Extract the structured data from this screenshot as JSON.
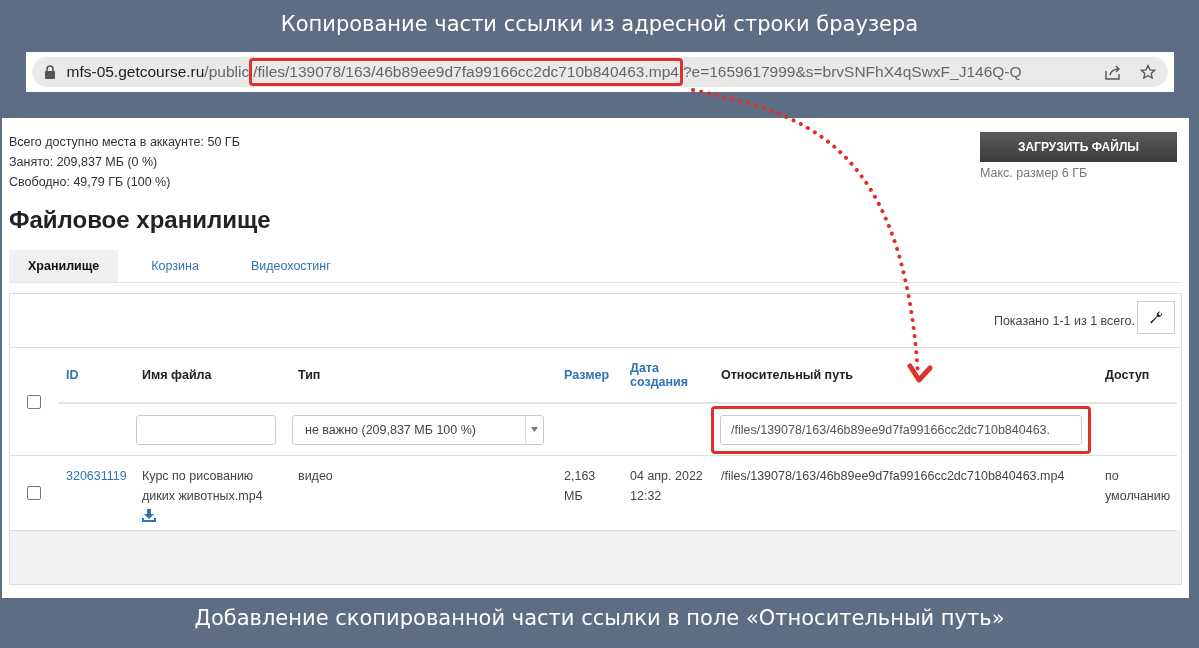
{
  "caption_top": "Копирование части ссылки из адресной строки браузера",
  "address_bar": {
    "url_parts": [
      {
        "text": "mfs-05.getcourse.ru",
        "kind": "host"
      },
      {
        "text": "/public",
        "kind": "path"
      },
      {
        "text": "/files/139078/163/46b89ee9d7fa99166cc2dc710b840463.mp4",
        "kind": "highlight"
      },
      {
        "text": "?e=1659617999&s=brvSNFhX4qSwxF_J146Q-Q",
        "kind": "path"
      }
    ]
  },
  "storage_info": [
    "Всего доступно места в аккаунте: 50 ГБ",
    "Занято: 209,837 МБ (0 %)",
    "Свободно: 49,79 ГБ (100 %)"
  ],
  "upload_button": "ЗАГРУЗИТЬ ФАЙЛЫ",
  "upload_note": "Макс. размер 6 ГБ",
  "title": "Файловое хранилище",
  "tabs": [
    {
      "label": "Хранилище",
      "selected": true
    },
    {
      "label": "Корзина",
      "selected": false
    },
    {
      "label": "Видеохостинг",
      "selected": false
    }
  ],
  "table": {
    "summary": "Показано 1-1 из 1 всего.",
    "select_all": {
      "checked": false
    },
    "columns": [
      {
        "label": "ID",
        "sortable": true
      },
      {
        "label": "Имя файла",
        "sortable": false
      },
      {
        "label": "Тип",
        "sortable": false
      },
      {
        "label": "Размер",
        "sortable": true
      },
      {
        "label": "Дата создания",
        "sortable": true
      },
      {
        "label": "Относительный путь",
        "sortable": false
      },
      {
        "label": "Доступ",
        "sortable": false
      }
    ],
    "filters": [
      {
        "kind": "none"
      },
      {
        "kind": "text",
        "highlighted": false
      },
      {
        "kind": "select",
        "value": "не важно (209,837 МБ 100 %)",
        "highlighted": false
      },
      {
        "kind": "none"
      },
      {
        "kind": "none"
      },
      {
        "kind": "text",
        "value": "/files/139078/163/46b89ee9d7fa99166cc2dc710b840463.",
        "highlighted": true
      },
      {
        "kind": "none"
      }
    ],
    "rows": [
      {
        "checked": false,
        "id": "320631119",
        "name": "Курс по рисованию диких животных.mp4",
        "type": "видео",
        "size": "2,163 МБ",
        "date": "04 апр. 2022 12:32",
        "path": "/files/139078/163/46b89ee9d7fa99166cc2dc710b840463.mp4",
        "access": "по умолчанию"
      }
    ]
  },
  "caption_bottom": "Добавление скопированной части ссылки в поле «Относительный путь»"
}
